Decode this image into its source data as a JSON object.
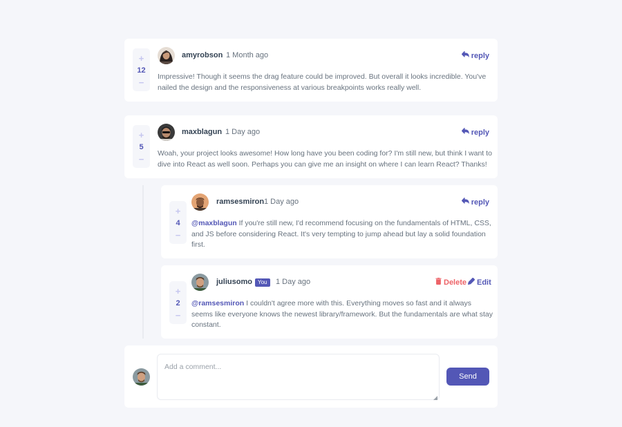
{
  "comments": [
    {
      "score": "12",
      "username": "amyrobson",
      "time": "1 Month ago",
      "action": "reply",
      "content": "Impressive! Though it seems the drag feature could be improved. But overall it looks incredible. You've nailed the design and the responsiveness at various breakpoints works really well."
    },
    {
      "score": "5",
      "username": "maxblagun",
      "time": "1 Day ago",
      "action": "reply",
      "content": "Woah, your project looks awesome! How long have you been coding for? I'm still new, but think I want to dive into React as well soon. Perhaps you can give me an insight on where I can learn React? Thanks!"
    }
  ],
  "replies": [
    {
      "score": "4",
      "username": "ramsesmiron",
      "time": "1 Day ago",
      "action": "reply",
      "mention": "@maxblagun",
      "content": " If you're still new, I'd recommend focusing on the fundamentals of HTML, CSS, and JS before considering React. It's very tempting to jump ahead but lay a solid foundation first."
    },
    {
      "score": "2",
      "username": "juliusomo",
      "badge": "You",
      "time": "1 Day ago",
      "delete_label": "Delete",
      "edit_label": "Edit",
      "mention": "@ramsesmiron",
      "content": " I couldn't agree more with this. Everything moves so fast and it always seems like everyone knows the newest library/framework. But the fundamentals are what stay constant."
    }
  ],
  "vote": {
    "plus": "+",
    "minus": "−"
  },
  "composer": {
    "placeholder": "Add a comment...",
    "send_label": "Send"
  },
  "colors": {
    "accent": "#5357b6",
    "danger": "#ed6368",
    "background": "#f5f6fa",
    "vote_light": "#c5c6ef"
  },
  "icons": [
    "reply-icon",
    "delete-icon",
    "edit-icon",
    "avatar"
  ]
}
